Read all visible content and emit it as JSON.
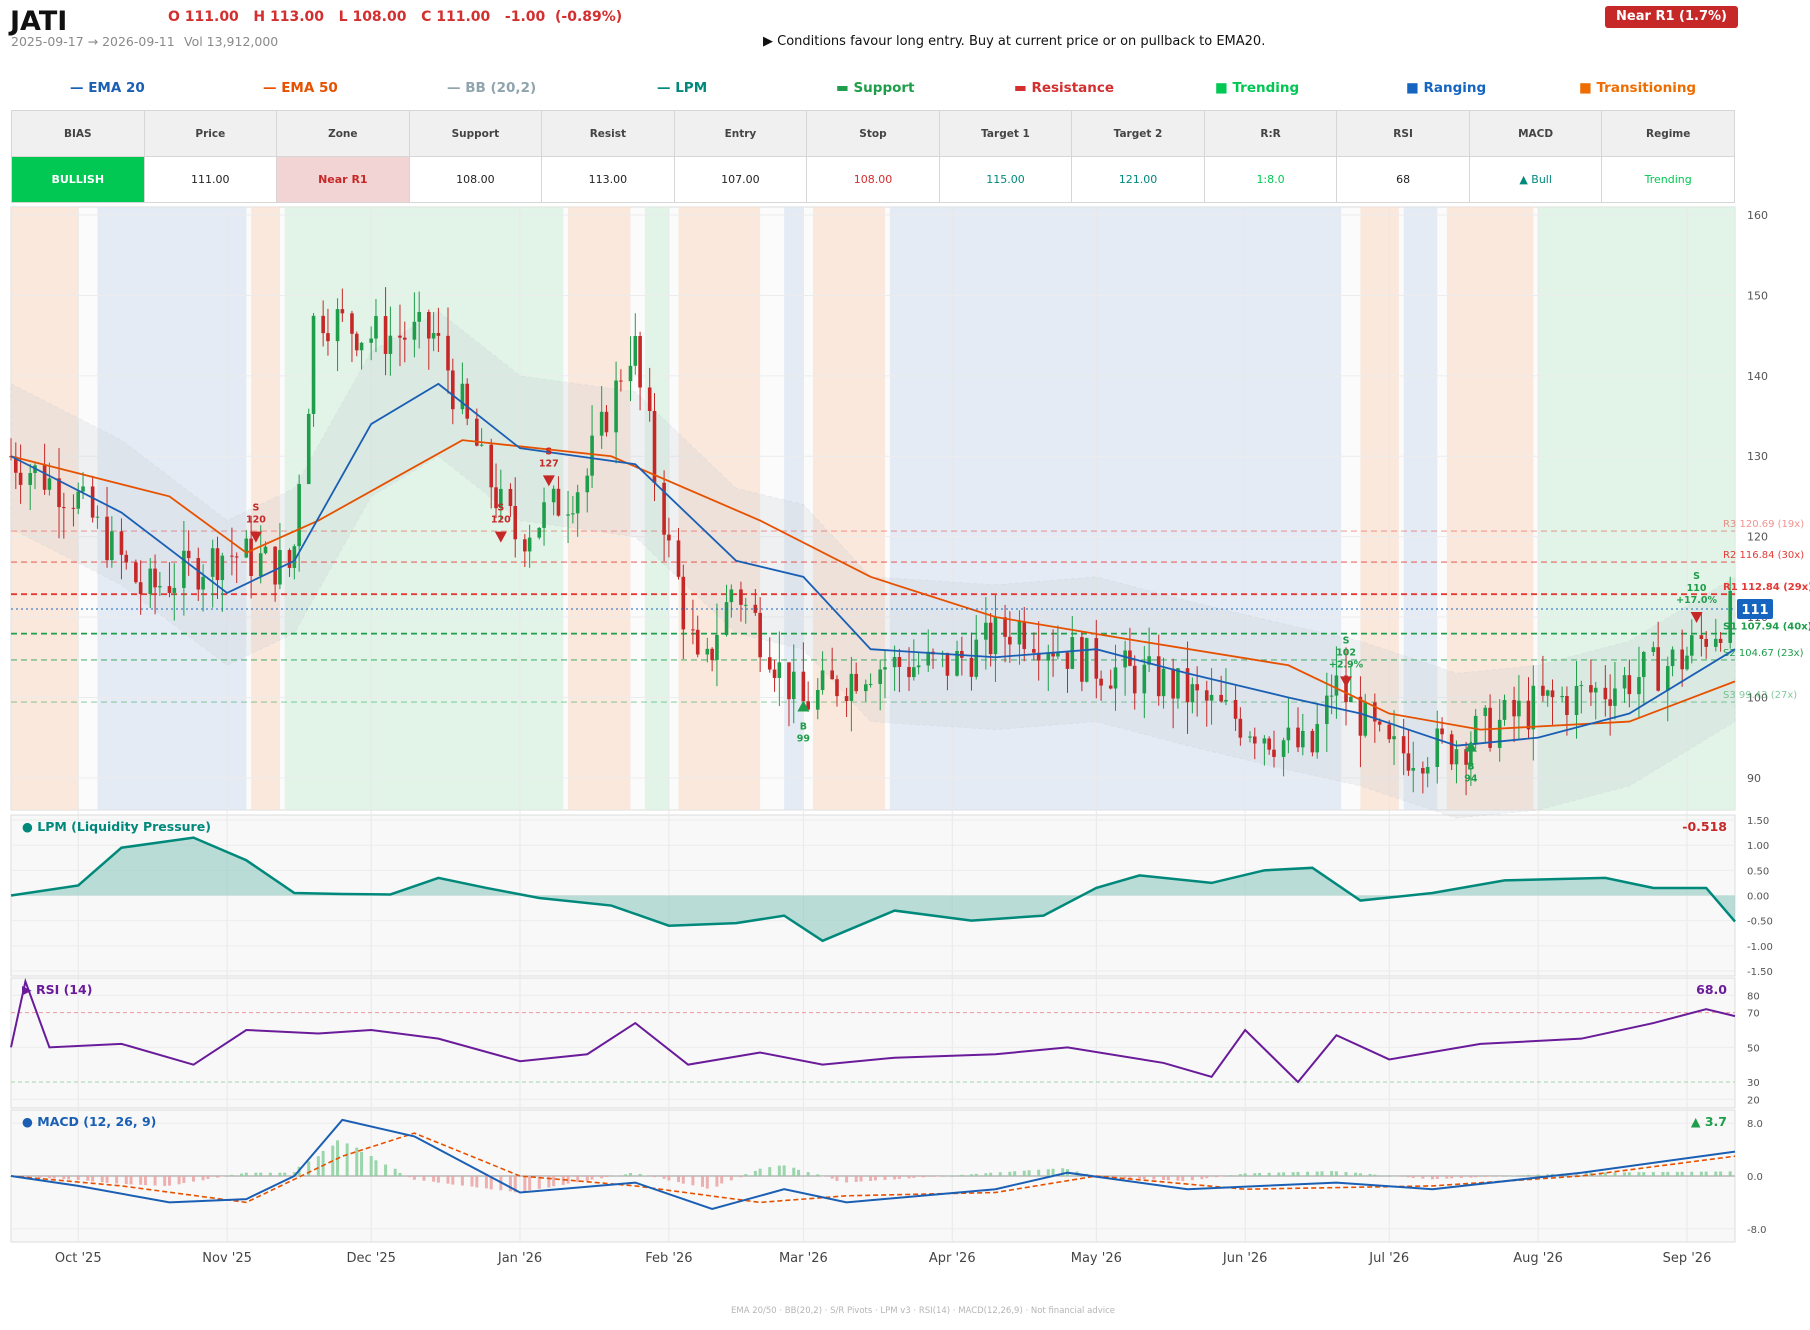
{
  "header": {
    "ticker": "JATI",
    "ohlc": "O 111.00   H 113.00   L 108.00   C 111.00   -1.00  (-0.89%)",
    "date_range": "2025-09-17 → 2026-09-11",
    "volume": "Vol 13,912,000",
    "condition": "▶  Conditions favour long entry. Buy at current price or on pullback to EMA20.",
    "zone_badge": "Near R1  (1.7%)"
  },
  "legend": [
    {
      "label": "— EMA 20",
      "color": "#1a5fb4"
    },
    {
      "label": "— EMA 50",
      "color": "#e65100"
    },
    {
      "label": "— BB (20,2)",
      "color": "#90a4ae"
    },
    {
      "label": "— LPM",
      "color": "#00897b"
    },
    {
      "label": "▬  Support",
      "color": "#1e9e4a"
    },
    {
      "label": "▬  Resistance",
      "color": "#d32f2f"
    },
    {
      "label": "■  Trending",
      "color": "#00c853"
    },
    {
      "label": "■  Ranging",
      "color": "#1565c0"
    },
    {
      "label": "■  Transitioning",
      "color": "#ef6c00"
    }
  ],
  "stats_table": {
    "headers": [
      "BIAS",
      "Price",
      "Zone",
      "Support",
      "Resist",
      "Entry",
      "Stop",
      "Target 1",
      "Target 2",
      "R:R",
      "RSI",
      "MACD",
      "Regime"
    ],
    "values": [
      "BULLISH",
      "111.00",
      "Near R1",
      "108.00",
      "113.00",
      "107.00",
      "108.00",
      "115.00",
      "121.00",
      "1:8.0",
      "68",
      "▲ Bull",
      "Trending"
    ]
  },
  "colors": {
    "bullish_bg": "#00c853",
    "near_r1_bg": "#f2d4d4",
    "stop": "#d32f2f",
    "target": "#00897b",
    "rr": "#00c853",
    "macd": "#00897b",
    "regime": "#00c853",
    "candle_up": "#1e9e4a",
    "candle_down": "#c62828",
    "ema20": "#1a5fb4",
    "ema50": "#e65100",
    "lpm": "#00897b",
    "rsi": "#6a1b9a",
    "macd_line": "#1a5fb4",
    "signal_line": "#e65100",
    "price_badge": "#1565c0"
  },
  "chart_data": {
    "type": "line",
    "title": "",
    "price_axis": {
      "ylim": [
        86,
        161
      ],
      "ticks": [
        90,
        100,
        110,
        120,
        130,
        140,
        150,
        160
      ]
    },
    "x_ticks": [
      "Oct '25",
      "Nov '25",
      "Dec '25",
      "Jan '26",
      "Feb '26",
      "Mar '26",
      "Apr '26",
      "May '26",
      "Jun '26",
      "Jul '26",
      "Aug '26",
      "Sep '26"
    ],
    "close_series": [
      {
        "date": "2025-09-17",
        "close": 130
      },
      {
        "date": "2025-10-01",
        "close": 125
      },
      {
        "date": "2025-10-15",
        "close": 113
      },
      {
        "date": "2025-11-01",
        "close": 118
      },
      {
        "date": "2025-11-15",
        "close": 116
      },
      {
        "date": "2025-11-20",
        "close": 148
      },
      {
        "date": "2025-12-01",
        "close": 145
      },
      {
        "date": "2025-12-15",
        "close": 145
      },
      {
        "date": "2025-12-25",
        "close": 128
      },
      {
        "date": "2026-01-01",
        "close": 120
      },
      {
        "date": "2026-01-15",
        "close": 127
      },
      {
        "date": "2026-01-25",
        "close": 145
      },
      {
        "date": "2026-02-01",
        "close": 120
      },
      {
        "date": "2026-02-08",
        "close": 102
      },
      {
        "date": "2026-02-15",
        "close": 114
      },
      {
        "date": "2026-03-01",
        "close": 99
      },
      {
        "date": "2026-03-15",
        "close": 104
      },
      {
        "date": "2026-04-01",
        "close": 104
      },
      {
        "date": "2026-04-15",
        "close": 109
      },
      {
        "date": "2026-05-01",
        "close": 104
      },
      {
        "date": "2026-05-15",
        "close": 102
      },
      {
        "date": "2026-06-01",
        "close": 97
      },
      {
        "date": "2026-06-15",
        "close": 93
      },
      {
        "date": "2026-06-20",
        "close": 102
      },
      {
        "date": "2026-07-01",
        "close": 93
      },
      {
        "date": "2026-07-15",
        "close": 94
      },
      {
        "date": "2026-08-01",
        "close": 99
      },
      {
        "date": "2026-08-15",
        "close": 101
      },
      {
        "date": "2026-09-01",
        "close": 105
      },
      {
        "date": "2026-09-11",
        "close": 111
      }
    ],
    "ema20_series": [
      {
        "date": "2025-09-17",
        "value": 130
      },
      {
        "date": "2025-10-10",
        "value": 123
      },
      {
        "date": "2025-11-01",
        "value": 113
      },
      {
        "date": "2025-11-15",
        "value": 117
      },
      {
        "date": "2025-12-01",
        "value": 134
      },
      {
        "date": "2025-12-15",
        "value": 139
      },
      {
        "date": "2026-01-01",
        "value": 131
      },
      {
        "date": "2026-01-25",
        "value": 129
      },
      {
        "date": "2026-02-15",
        "value": 117
      },
      {
        "date": "2026-03-01",
        "value": 115
      },
      {
        "date": "2026-03-15",
        "value": 106
      },
      {
        "date": "2026-04-10",
        "value": 105
      },
      {
        "date": "2026-05-01",
        "value": 106
      },
      {
        "date": "2026-05-20",
        "value": 103
      },
      {
        "date": "2026-06-10",
        "value": 100
      },
      {
        "date": "2026-06-25",
        "value": 98
      },
      {
        "date": "2026-07-15",
        "value": 94
      },
      {
        "date": "2026-08-01",
        "value": 95
      },
      {
        "date": "2026-08-20",
        "value": 98
      },
      {
        "date": "2026-09-11",
        "value": 106
      }
    ],
    "ema50_series": [
      {
        "date": "2025-09-17",
        "value": 130
      },
      {
        "date": "2025-10-20",
        "value": 125
      },
      {
        "date": "2025-11-05",
        "value": 118
      },
      {
        "date": "2025-11-20",
        "value": 122
      },
      {
        "date": "2025-12-20",
        "value": 132
      },
      {
        "date": "2026-01-20",
        "value": 130
      },
      {
        "date": "2026-02-20",
        "value": 122
      },
      {
        "date": "2026-03-15",
        "value": 115
      },
      {
        "date": "2026-04-10",
        "value": 110
      },
      {
        "date": "2026-05-10",
        "value": 107
      },
      {
        "date": "2026-06-10",
        "value": 104
      },
      {
        "date": "2026-07-01",
        "value": 98
      },
      {
        "date": "2026-07-20",
        "value": 96
      },
      {
        "date": "2026-08-20",
        "value": 97
      },
      {
        "date": "2026-09-11",
        "value": 102
      }
    ],
    "support_resistance": [
      {
        "label": "R3 120.69 (19x)",
        "value": 120.69,
        "kind": "resistance"
      },
      {
        "label": "R2 116.84 (30x)",
        "value": 116.84,
        "kind": "resistance"
      },
      {
        "label": "R1 112.84 (29x)",
        "value": 112.84,
        "kind": "resistance"
      },
      {
        "label": "S1 107.94 (40x)",
        "value": 107.94,
        "kind": "support"
      },
      {
        "label": "S2 104.67 (23x)",
        "value": 104.67,
        "kind": "support"
      },
      {
        "label": "S3 99.43 (27x)",
        "value": 99.43,
        "kind": "support"
      }
    ],
    "current_price": {
      "value": 111,
      "label": "111"
    },
    "signals": [
      {
        "type": "S",
        "text": "S\n120",
        "date": "2025-11-07",
        "price": 120
      },
      {
        "type": "S",
        "text": "S\n120",
        "date": "2025-12-28",
        "price": 120
      },
      {
        "type": "S",
        "text": "S\n127",
        "date": "2026-01-07",
        "price": 127
      },
      {
        "type": "B",
        "text": "B\n99",
        "date": "2026-03-01",
        "price": 99
      },
      {
        "type": "S",
        "text": "S\n102\n+2.9%",
        "date": "2026-06-22",
        "price": 102
      },
      {
        "type": "B",
        "text": "B\n94",
        "date": "2026-07-18",
        "price": 94
      },
      {
        "type": "S",
        "text": "S\n110\n+17.0%",
        "date": "2026-09-03",
        "price": 110
      }
    ],
    "regimes": [
      {
        "from": "2025-09-17",
        "to": "2025-10-01",
        "regime": "Transitioning"
      },
      {
        "from": "2025-10-05",
        "to": "2025-11-05",
        "regime": "Ranging"
      },
      {
        "from": "2025-11-06",
        "to": "2025-11-12",
        "regime": "Transitioning"
      },
      {
        "from": "2025-11-13",
        "to": "2026-01-10",
        "regime": "Trending"
      },
      {
        "from": "2026-01-11",
        "to": "2026-01-24",
        "regime": "Transitioning"
      },
      {
        "from": "2026-01-27",
        "to": "2026-02-01",
        "regime": "Trending"
      },
      {
        "from": "2026-02-03",
        "to": "2026-02-20",
        "regime": "Transitioning"
      },
      {
        "from": "2026-02-25",
        "to": "2026-03-01",
        "regime": "Ranging"
      },
      {
        "from": "2026-03-03",
        "to": "2026-03-18",
        "regime": "Transitioning"
      },
      {
        "from": "2026-03-19",
        "to": "2026-06-21",
        "regime": "Ranging"
      },
      {
        "from": "2026-06-25",
        "to": "2026-07-03",
        "regime": "Transitioning"
      },
      {
        "from": "2026-07-04",
        "to": "2026-07-11",
        "regime": "Ranging"
      },
      {
        "from": "2026-07-13",
        "to": "2026-07-31",
        "regime": "Transitioning"
      },
      {
        "from": "2026-08-01",
        "to": "2026-09-11",
        "regime": "Trending"
      }
    ],
    "lpm": {
      "title": "● LPM (Liquidity Pressure)",
      "last_value": "-0.518",
      "ylim": [
        -1.6,
        1.6
      ],
      "ticks": [
        "1.50",
        "1.00",
        "0.50",
        "0.00",
        "-0.50",
        "-1.00",
        "-1.50"
      ],
      "series": [
        {
          "date": "2025-09-17",
          "value": 0
        },
        {
          "date": "2025-10-01",
          "value": 0.2
        },
        {
          "date": "2025-10-10",
          "value": 0.95
        },
        {
          "date": "2025-10-25",
          "value": 1.15
        },
        {
          "date": "2025-11-05",
          "value": 0.7
        },
        {
          "date": "2025-11-15",
          "value": 0.05
        },
        {
          "date": "2025-11-25",
          "value": 0.03
        },
        {
          "date": "2025-12-05",
          "value": 0.02
        },
        {
          "date": "2025-12-15",
          "value": 0.35
        },
        {
          "date": "2025-12-25",
          "value": 0.15
        },
        {
          "date": "2026-01-05",
          "value": -0.05
        },
        {
          "date": "2026-01-20",
          "value": -0.2
        },
        {
          "date": "2026-02-01",
          "value": -0.6
        },
        {
          "date": "2026-02-15",
          "value": -0.55
        },
        {
          "date": "2026-02-25",
          "value": -0.4
        },
        {
          "date": "2026-03-05",
          "value": -0.9
        },
        {
          "date": "2026-03-20",
          "value": -0.3
        },
        {
          "date": "2026-04-05",
          "value": -0.5
        },
        {
          "date": "2026-04-20",
          "value": -0.4
        },
        {
          "date": "2026-05-01",
          "value": 0.15
        },
        {
          "date": "2026-05-10",
          "value": 0.4
        },
        {
          "date": "2026-05-25",
          "value": 0.25
        },
        {
          "date": "2026-06-05",
          "value": 0.5
        },
        {
          "date": "2026-06-15",
          "value": 0.55
        },
        {
          "date": "2026-06-25",
          "value": -0.1
        },
        {
          "date": "2026-07-10",
          "value": 0.05
        },
        {
          "date": "2026-07-25",
          "value": 0.3
        },
        {
          "date": "2026-08-15",
          "value": 0.35
        },
        {
          "date": "2026-08-25",
          "value": 0.15
        },
        {
          "date": "2026-09-05",
          "value": 0.15
        },
        {
          "date": "2026-09-11",
          "value": -0.518
        }
      ]
    },
    "rsi": {
      "title": "▶ RSI (14)",
      "last_value": "68.0",
      "ylim": [
        15,
        90
      ],
      "ticks": [
        80,
        70,
        50,
        30,
        20
      ],
      "series": [
        {
          "date": "2025-09-17",
          "value": 50
        },
        {
          "date": "2025-09-20",
          "value": 88
        },
        {
          "date": "2025-09-25",
          "value": 50
        },
        {
          "date": "2025-10-10",
          "value": 52
        },
        {
          "date": "2025-10-25",
          "value": 40
        },
        {
          "date": "2025-11-05",
          "value": 60
        },
        {
          "date": "2025-11-20",
          "value": 58
        },
        {
          "date": "2025-12-01",
          "value": 60
        },
        {
          "date": "2025-12-15",
          "value": 55
        },
        {
          "date": "2026-01-01",
          "value": 42
        },
        {
          "date": "2026-01-15",
          "value": 46
        },
        {
          "date": "2026-01-25",
          "value": 64
        },
        {
          "date": "2026-02-05",
          "value": 40
        },
        {
          "date": "2026-02-20",
          "value": 47
        },
        {
          "date": "2026-03-05",
          "value": 40
        },
        {
          "date": "2026-03-20",
          "value": 44
        },
        {
          "date": "2026-04-10",
          "value": 46
        },
        {
          "date": "2026-04-25",
          "value": 50
        },
        {
          "date": "2026-05-15",
          "value": 41
        },
        {
          "date": "2026-05-25",
          "value": 33
        },
        {
          "date": "2026-06-01",
          "value": 60
        },
        {
          "date": "2026-06-12",
          "value": 30
        },
        {
          "date": "2026-06-20",
          "value": 57
        },
        {
          "date": "2026-07-01",
          "value": 43
        },
        {
          "date": "2026-07-20",
          "value": 52
        },
        {
          "date": "2026-08-10",
          "value": 55
        },
        {
          "date": "2026-08-25",
          "value": 64
        },
        {
          "date": "2026-09-05",
          "value": 72
        },
        {
          "date": "2026-09-11",
          "value": 68
        }
      ]
    },
    "macd": {
      "title": "● MACD (12, 26, 9)",
      "last_value": "▲ 3.7",
      "ylim": [
        -10,
        10
      ],
      "ticks": [
        "8.0",
        "0.0",
        "-8.0"
      ],
      "macd_series": [
        {
          "date": "2025-09-17",
          "value": 0
        },
        {
          "date": "2025-10-01",
          "value": -1.5
        },
        {
          "date": "2025-10-20",
          "value": -4
        },
        {
          "date": "2025-11-05",
          "value": -3.5
        },
        {
          "date": "2025-11-15",
          "value": 0
        },
        {
          "date": "2025-11-25",
          "value": 8.5
        },
        {
          "date": "2025-12-10",
          "value": 6
        },
        {
          "date": "2026-01-01",
          "value": -2.5
        },
        {
          "date": "2026-01-25",
          "value": -1
        },
        {
          "date": "2026-02-10",
          "value": -5
        },
        {
          "date": "2026-02-25",
          "value": -2
        },
        {
          "date": "2026-03-10",
          "value": -4
        },
        {
          "date": "2026-04-10",
          "value": -2
        },
        {
          "date": "2026-04-25",
          "value": 0.5
        },
        {
          "date": "2026-05-20",
          "value": -2
        },
        {
          "date": "2026-06-20",
          "value": -1
        },
        {
          "date": "2026-07-10",
          "value": -2
        },
        {
          "date": "2026-08-10",
          "value": 0.5
        },
        {
          "date": "2026-09-11",
          "value": 3.7
        }
      ],
      "signal_series": [
        {
          "date": "2025-09-17",
          "value": 0
        },
        {
          "date": "2025-10-10",
          "value": -1.5
        },
        {
          "date": "2025-11-05",
          "value": -4
        },
        {
          "date": "2025-11-25",
          "value": 3
        },
        {
          "date": "2025-12-10",
          "value": 6.5
        },
        {
          "date": "2026-01-01",
          "value": 0
        },
        {
          "date": "2026-01-25",
          "value": -1.5
        },
        {
          "date": "2026-02-20",
          "value": -4
        },
        {
          "date": "2026-03-10",
          "value": -3
        },
        {
          "date": "2026-04-10",
          "value": -2.5
        },
        {
          "date": "2026-05-01",
          "value": 0
        },
        {
          "date": "2026-06-01",
          "value": -2
        },
        {
          "date": "2026-07-10",
          "value": -1.5
        },
        {
          "date": "2026-08-10",
          "value": 0
        },
        {
          "date": "2026-09-11",
          "value": 3
        }
      ]
    }
  },
  "footer": "EMA 20/50  ·  BB(20,2)  ·  S/R Pivots  ·  LPM v3  ·  RSI(14)  ·  MACD(12,26,9)  ·  Not financial advice"
}
